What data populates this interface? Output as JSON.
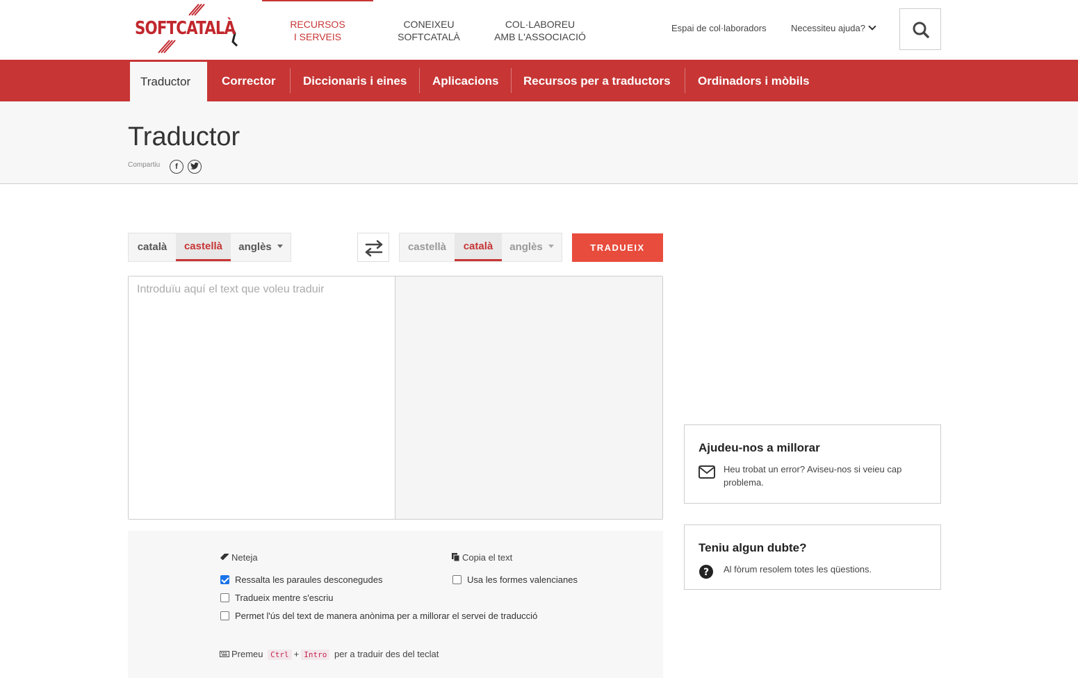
{
  "brand": {
    "logo_text": "SOFTCATALÀ"
  },
  "top_nav": [
    {
      "label_line1": "RECURSOS",
      "label_line2": "I SERVEIS"
    },
    {
      "label_line1": "CONEIXEU",
      "label_line2": "SOFTCATALÀ"
    },
    {
      "label_line1": "COL·LABOREU",
      "label_line2": "AMB L'ASSOCIACIÓ"
    }
  ],
  "top_links": {
    "contributors": "Espai de col·laboradors",
    "help": "Necessiteu ajuda?"
  },
  "menu": [
    "Traductor",
    "Corrector",
    "Diccionaris i eines",
    "Aplicacions",
    "Recursos per a traductors",
    "Ordinadors i mòbils"
  ],
  "page": {
    "title": "Traductor",
    "share_label": "Compartiu"
  },
  "source_langs": [
    "català",
    "castellà",
    "anglès"
  ],
  "target_langs": [
    "castellà",
    "català",
    "anglès"
  ],
  "translate_button": "TRADUEIX",
  "source_placeholder": "Introduïu aquí el text que voleu traduir",
  "options": {
    "clear": "Neteja",
    "copy": "Copia el text",
    "highlight_unknown": "Ressalta les paraules desconegudes",
    "valencian_forms": "Usa les formes valencianes",
    "translate_while_typing": "Tradueix mentre s'escriu",
    "anonymous_use": "Permet l'ús del text de manera anònima per a millorar el servei de traducció",
    "shortcut_pre": "Premeu",
    "shortcut_key1": "Ctrl",
    "shortcut_plus": "+",
    "shortcut_key2": "Intro",
    "shortcut_post": "per a traduir des del teclat"
  },
  "cards": {
    "improve_title": "Ajudeu-nos a millorar",
    "improve_text": "Heu trobat un error? Aviseu-nos si veieu cap problema.",
    "doubt_title": "Teniu algun dubte?",
    "doubt_text": "Al fòrum resolem totes les qüestions."
  },
  "colors": {
    "brand_red": "#c73535",
    "button_red": "#e84c3d"
  }
}
